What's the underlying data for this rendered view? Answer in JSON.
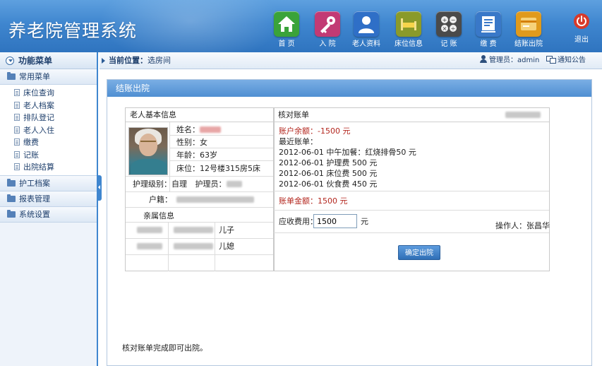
{
  "colors": {
    "header": "#3f86cf",
    "accent_red": "#b3261e",
    "link": "#1d3e6b"
  },
  "header": {
    "title": "养老院管理系统",
    "nav": [
      {
        "label": "首 页",
        "icon": "home-icon",
        "color": "#3aa33a"
      },
      {
        "label": "入 院",
        "icon": "key-icon",
        "color": "#c23a74"
      },
      {
        "label": "老人资料",
        "icon": "user-icon",
        "color": "#2f6fc7"
      },
      {
        "label": "床位信息",
        "icon": "bed-icon",
        "color": "#8a9a2a"
      },
      {
        "label": "记 账",
        "icon": "calculator-icon",
        "color": "#4a4a4a"
      },
      {
        "label": "缴 费",
        "icon": "receipt-icon",
        "color": "#3978c8"
      },
      {
        "label": "结账出院",
        "icon": "card-icon",
        "color": "#e09a1c"
      }
    ],
    "logout_label": "退出"
  },
  "sidebar": {
    "title": "功能菜单",
    "groups": [
      {
        "label": "常用菜单",
        "items": [
          "床位查询",
          "老人档案",
          "排队登记",
          "老人入住",
          "缴费",
          "记账",
          "出院结算"
        ]
      },
      {
        "label": "护工档案"
      },
      {
        "label": "报表管理"
      },
      {
        "label": "系统设置"
      }
    ]
  },
  "location": {
    "prefix": "当前位置：",
    "value": "选房间"
  },
  "topbar": {
    "admin_prefix": "管理员：",
    "admin_name": "admin",
    "notice": "通知公告"
  },
  "panel": {
    "title": "结账出院",
    "info": {
      "header": "老人基本信息",
      "name_label": "姓名：",
      "gender_label": "性别：",
      "gender": "女",
      "age_label": "年龄：",
      "age": "63岁",
      "bed_label": "床位：",
      "bed": "12号楼315房5床",
      "care_level_label": "护理级别：",
      "care_level": "自理",
      "caregiver_label": "护理员：",
      "hukou_label": "户籍：",
      "relatives_header": "亲属信息",
      "relatives": [
        {
          "relation": "儿子"
        },
        {
          "relation": "儿媳"
        }
      ]
    },
    "account": {
      "header": "核对账单",
      "balance": "账户余额：-1500 元",
      "recent_label": "最近账单：",
      "entries": [
        "2012-06-01  中午加餐：红烧排骨50 元",
        "2012-06-01  护理费   500 元",
        "2012-06-01  床位费   500 元",
        "2012-06-01  伙食费   450 元"
      ],
      "bill_amount": "账单金额：1500 元",
      "fee_label": "应收费用：",
      "fee_value": "1500",
      "fee_unit": "元",
      "operator": "操作人：张昌华",
      "confirm_label": "确定出院"
    },
    "footnote": "核对账单完成即可出院。"
  }
}
